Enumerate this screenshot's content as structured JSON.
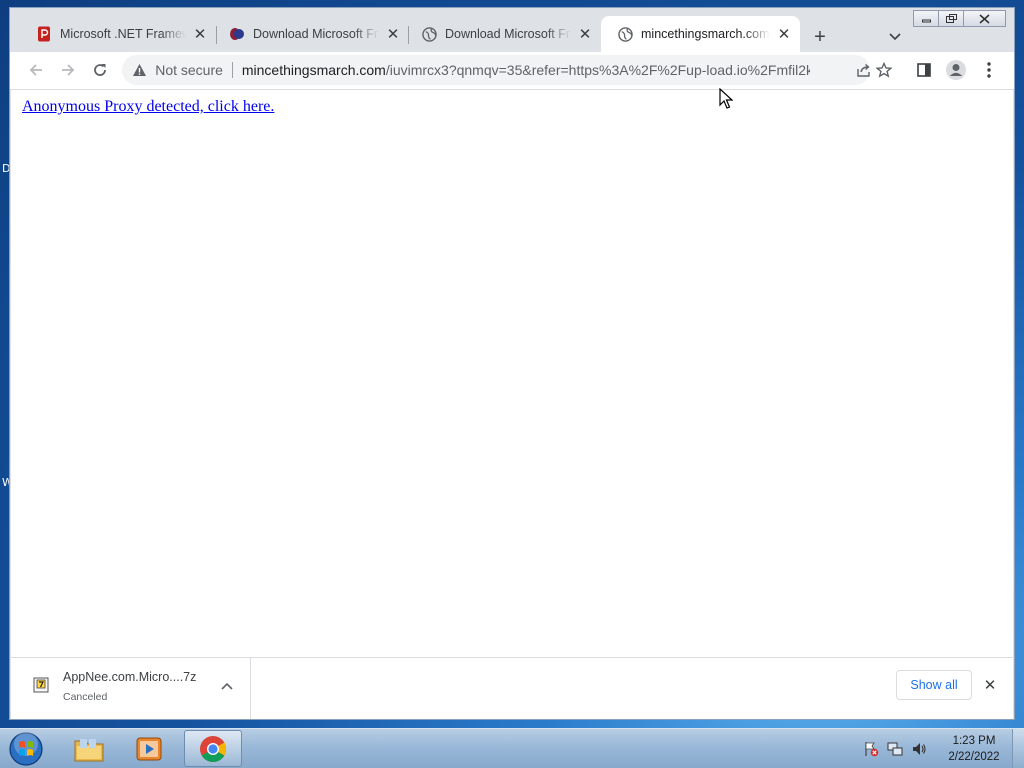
{
  "browser": {
    "tabs": [
      {
        "title": "Microsoft .NET Framewo",
        "favicon": "pdf-icon",
        "active": false
      },
      {
        "title": "Download Microsoft Fra",
        "favicon": "site-logo-icon",
        "active": false
      },
      {
        "title": "Download Microsoft Fra",
        "favicon": "globe-icon",
        "active": false
      },
      {
        "title": "mincethingsmarch.com",
        "favicon": "globe-icon",
        "active": true
      }
    ],
    "address": {
      "security_label": "Not secure",
      "host": "mincethingsmarch.com",
      "path": "/iuvimrcx3?qnmqv=35&refer=https%3A%2F%2Fup-load.io%2Fmfil2kce..."
    }
  },
  "page": {
    "link_text": "Anonymous Proxy detected, click here."
  },
  "downloads": {
    "item": {
      "name": "AppNee.com.Micro....7z",
      "status": "Canceled"
    },
    "show_all_label": "Show all"
  },
  "taskbar": {
    "time": "1:23 PM",
    "date": "2/22/2022"
  },
  "desktop": {
    "edge_letters": [
      "D",
      "W"
    ]
  },
  "colors": {
    "link": "#0000ee",
    "accent": "#1a73e8",
    "tabstrip": "#dee1e6"
  }
}
